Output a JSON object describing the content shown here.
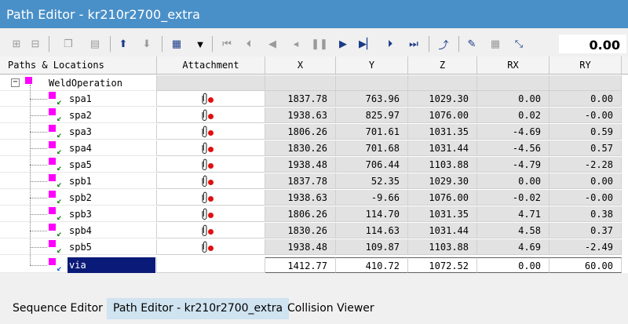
{
  "window": {
    "title": "Path Editor - kr210r2700_extra"
  },
  "toolbar": {
    "value": "0.00",
    "icons": [
      "add-location-icon",
      "remove-location-icon",
      "copy-icon",
      "paste-icon",
      "move-up-icon",
      "move-down-icon",
      "attribute-table-icon",
      "dropdown-icon",
      "jump-to-start-icon",
      "step-to-start-icon",
      "step-back-icon",
      "play-back-icon",
      "pause-icon",
      "play-icon",
      "step-forward-icon",
      "step-to-end-icon",
      "jump-to-end-icon",
      "teach-icon",
      "properties-icon",
      "grid-icon",
      "snap-icon"
    ]
  },
  "table": {
    "columns": [
      "Paths & Locations",
      "Attachment",
      "X",
      "Y",
      "Z",
      "RX",
      "RY"
    ],
    "operation": "WeldOperation",
    "rows": [
      {
        "name": "spa1",
        "x": "1837.78",
        "y": "763.96",
        "z": "1029.30",
        "rx": "0.00",
        "ry": "0.00"
      },
      {
        "name": "spa2",
        "x": "1938.63",
        "y": "825.97",
        "z": "1076.00",
        "rx": "0.02",
        "ry": "-0.00"
      },
      {
        "name": "spa3",
        "x": "1806.26",
        "y": "701.61",
        "z": "1031.35",
        "rx": "-4.69",
        "ry": "0.59"
      },
      {
        "name": "spa4",
        "x": "1830.26",
        "y": "701.68",
        "z": "1031.44",
        "rx": "-4.56",
        "ry": "0.57"
      },
      {
        "name": "spa5",
        "x": "1938.48",
        "y": "706.44",
        "z": "1103.88",
        "rx": "-4.79",
        "ry": "-2.28"
      },
      {
        "name": "spb1",
        "x": "1837.78",
        "y": "52.35",
        "z": "1029.30",
        "rx": "0.00",
        "ry": "0.00"
      },
      {
        "name": "spb2",
        "x": "1938.63",
        "y": "-9.66",
        "z": "1076.00",
        "rx": "-0.02",
        "ry": "-0.00"
      },
      {
        "name": "spb3",
        "x": "1806.26",
        "y": "114.70",
        "z": "1031.35",
        "rx": "4.71",
        "ry": "0.38"
      },
      {
        "name": "spb4",
        "x": "1830.26",
        "y": "114.63",
        "z": "1031.44",
        "rx": "4.58",
        "ry": "0.37"
      },
      {
        "name": "spb5",
        "x": "1938.48",
        "y": "109.87",
        "z": "1103.88",
        "rx": "4.69",
        "ry": "-2.49"
      }
    ],
    "selected": {
      "name": "via",
      "x": "1412.77",
      "y": "410.72",
      "z": "1072.52",
      "rx": "0.00",
      "ry": "60.00"
    }
  },
  "tabs": [
    {
      "label": "Sequence Editor"
    },
    {
      "label": "Path Editor - kr210r2700_extra"
    },
    {
      "label": "Collision Viewer"
    }
  ],
  "colors": {
    "titlebar": "#4a90c8",
    "selection": "#0a1a78",
    "active_tab": "#cfe3f0"
  }
}
